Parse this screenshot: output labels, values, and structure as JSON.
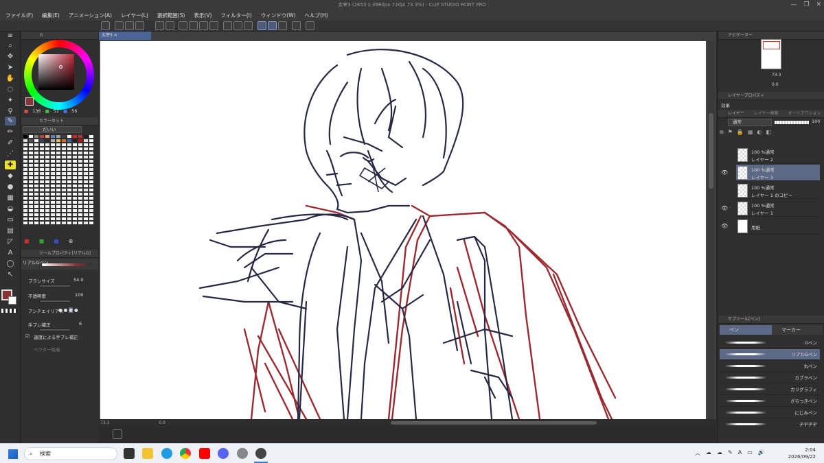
{
  "window": {
    "title": "太宰3 (2653 x 3980px 72dpi 73.3%) - CLIP STUDIO PAINT PRO"
  },
  "menu": [
    "ファイル(F)",
    "編集(E)",
    "アニメーション(A)",
    "レイヤー(L)",
    "選択範囲(S)",
    "表示(V)",
    "フィルター(I)",
    "ウィンドウ(W)",
    "ヘルプ(H)"
  ],
  "document_tab": "太宰3",
  "color_panel": {
    "tab": "カ",
    "rgb": {
      "r": "136",
      "g": "51",
      "b": "56"
    },
    "main_color": "#883338"
  },
  "color_set": {
    "tab": "カラーセット",
    "selected": "だいい"
  },
  "tool_property": {
    "tab": "ツールプロパティ[リアルG]",
    "brush_name": "リアルGペン",
    "brush_size_label": "ブラシサイズ",
    "brush_size_value": "54.0",
    "opacity_label": "不透明度",
    "opacity_value": "100",
    "antialias_label": "アンチエイリアス",
    "stabilization_label": "手ブレ補正",
    "stabilization_value": "6",
    "speed_stab_label": "速度による手ブレ補正",
    "vector_label": "ベクター吸着"
  },
  "canvas_status": {
    "zoom": "73.3",
    "angle": "0.0"
  },
  "navigator": {
    "tab": "ナビゲーター",
    "zoom": "73.3",
    "rotation": "0.0"
  },
  "layer_property": {
    "tab": "レイヤープロパティ",
    "effect_label": "効果"
  },
  "layers_panel": {
    "tab": "レイヤー",
    "tab2": "レイヤー検索",
    "tab3": "オートアクション",
    "blend_mode": "通常",
    "opacity": "100",
    "items": [
      {
        "meta": "100 %通常",
        "name": "レイヤー 2",
        "visible": false,
        "selected": false
      },
      {
        "meta": "100 %通常",
        "name": "レイヤー 3",
        "visible": true,
        "selected": true
      },
      {
        "meta": "100 %通常",
        "name": "レイヤー 1 のコピー",
        "visible": false,
        "selected": false
      },
      {
        "meta": "100 %通常",
        "name": "レイヤー 1",
        "visible": true,
        "selected": false
      },
      {
        "meta": "",
        "name": "用紙",
        "visible": true,
        "selected": false
      }
    ]
  },
  "subtool_panel": {
    "tab": "サブツール[ペン]",
    "groups": [
      "ペン",
      "マーカー"
    ],
    "brushes": [
      "Gペン",
      "リアルGペン",
      "丸ペン",
      "カブラペン",
      "カリグラフィ",
      "ざらつきペン",
      "にじみペン",
      "ヂヂヂヂ"
    ],
    "selected_index": 1
  },
  "taskbar": {
    "search_placeholder": "検索",
    "time": "2:04",
    "date": "2026/09/22",
    "lang": "A"
  },
  "colors": {
    "sketch_navy": "#262845",
    "sketch_red": "#9b2b30",
    "accent": "#5b6886"
  }
}
